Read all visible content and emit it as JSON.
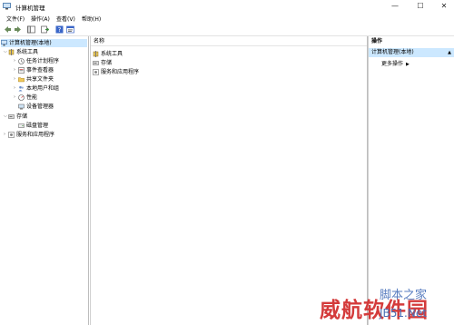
{
  "window": {
    "title": "计算机管理",
    "minimize_symbol": "—",
    "maximize_symbol": "☐",
    "close_symbol": "✕"
  },
  "menu": {
    "items": [
      "文件(F)",
      "操作(A)",
      "查看(V)",
      "帮助(H)"
    ]
  },
  "toolbar": {
    "icons": [
      "back-arrow-icon",
      "forward-arrow-icon",
      "console-tree-icon",
      "export-list-icon",
      "help-icon",
      "properties-icon"
    ]
  },
  "tree": {
    "root": "计算机管理(本地)",
    "system_tools": "系统工具",
    "task_scheduler": "任务计划程序",
    "event_viewer": "事件查看器",
    "shared_folders": "共享文件夹",
    "local_users": "本地用户和组",
    "performance": "性能",
    "device_manager": "设备管理器",
    "storage": "存储",
    "disk_management": "磁盘管理",
    "services_apps": "服务和应用程序"
  },
  "main": {
    "column_name": "名称",
    "items": [
      "系统工具",
      "存储",
      "服务和应用程序"
    ]
  },
  "actions": {
    "title": "操作",
    "section": "计算机管理(本地)",
    "more": "更多操作"
  },
  "watermark": {
    "line1": "脚本之家",
    "line2": "威航软件园",
    "line3": "JB51.Net"
  },
  "colors": {
    "selection": "#cce8ff",
    "watermark_red": "#d43b3b",
    "watermark_blue": "#4a6fb5"
  }
}
